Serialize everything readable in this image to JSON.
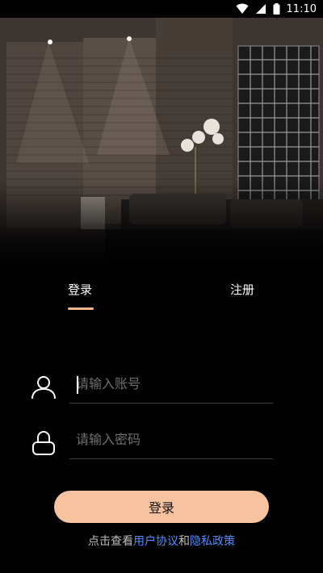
{
  "status_bar": {
    "time": "11:10",
    "icons": [
      "wifi-icon",
      "signal-icon",
      "battery-icon"
    ]
  },
  "hero": {
    "image": "hotel-room-photo",
    "description_icon": "bedroom-image"
  },
  "tabs": [
    {
      "label": "登录",
      "active": true
    },
    {
      "label": "注册",
      "active": false
    }
  ],
  "form": {
    "username": {
      "placeholder": "请输入账号",
      "value": "",
      "icon": "user-icon"
    },
    "password": {
      "placeholder": "请输入密码",
      "value": "",
      "icon": "lock-icon"
    }
  },
  "login_button": {
    "label": "登录"
  },
  "agreement": {
    "prefix": "点击查看",
    "user_agreement": "用户协议",
    "conjunction": "和",
    "privacy_policy": "隐私政策"
  },
  "colors": {
    "accent": "#f7c29f",
    "tab_underline": "#f0b48a",
    "link": "#4f8cff",
    "background": "#000000"
  }
}
